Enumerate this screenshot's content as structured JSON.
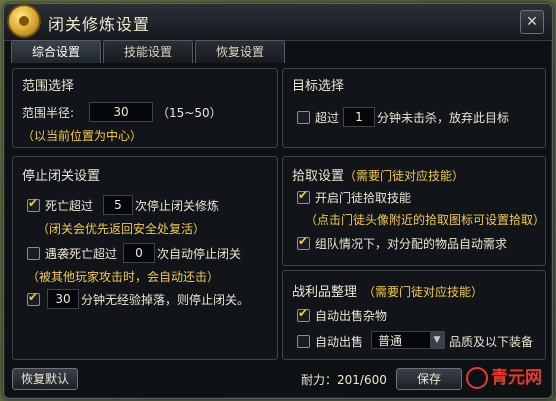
{
  "window": {
    "title": "闭关修炼设置",
    "close": "✕"
  },
  "tabs": [
    {
      "label": "综合设置",
      "active": true
    },
    {
      "label": "技能设置",
      "active": false
    },
    {
      "label": "恢复设置",
      "active": false
    }
  ],
  "range": {
    "title": "范围选择",
    "radius_label": "范围半径:",
    "radius_value": "30",
    "radius_hint": "（15~50）",
    "center_note": "（以当前位置为中心）"
  },
  "target": {
    "title": "目标选择",
    "pre": "超过",
    "value": "1",
    "post": "分钟未击杀，放弃此目标",
    "checked": false
  },
  "stop": {
    "title": "停止闭关设置",
    "death_pre": "死亡超过",
    "death_value": "5",
    "death_post": "次停止闭关修炼",
    "death_checked": true,
    "death_note": "（闭关会优先返回安全处复活）",
    "attack_pre": "遇袭死亡超过",
    "attack_value": "0",
    "attack_post": "次自动停止闭关",
    "attack_checked": false,
    "attack_note": "（被其他玩家攻击时，会自动还击）",
    "exp_value": "30",
    "exp_post": "分钟无经验掉落，则停止闭关。",
    "exp_checked": true
  },
  "pickup": {
    "title": "拾取设置",
    "title_note": "（需要门徒对应技能）",
    "enable_label": "开启门徒拾取技能",
    "enable_checked": true,
    "enable_note": "（点击门徒头像附近的拾取图标可设置拾取）",
    "team_label": "组队情况下，对分配的物品自动需求",
    "team_checked": true
  },
  "loot": {
    "title": "战利品整理",
    "title_note": "（需要门徒对应技能）",
    "sell_junk_label": "自动出售杂物",
    "sell_junk_checked": true,
    "sell_label": "自动出售",
    "sell_checked": false,
    "quality_value": "普通",
    "quality_post": "品质及以下装备"
  },
  "footer": {
    "reset_label": "恢复默认",
    "durability": "耐力：201/600",
    "save_label": "保存"
  },
  "watermark": "青元网"
}
